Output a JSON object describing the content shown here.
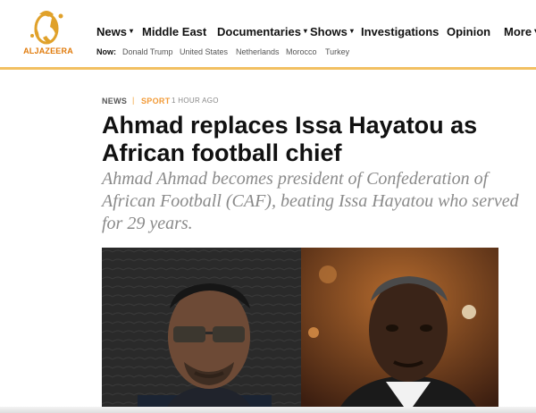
{
  "brand": {
    "name": "ALJAZEERA",
    "accent": "#f2a43a"
  },
  "nav": {
    "items": [
      {
        "label": "News",
        "dropdown": true
      },
      {
        "label": "Middle East",
        "dropdown": false
      },
      {
        "label": "Documentaries",
        "dropdown": true
      },
      {
        "label": "Shows",
        "dropdown": true
      },
      {
        "label": "Investigations",
        "dropdown": false
      },
      {
        "label": "Opinion",
        "dropdown": false
      },
      {
        "label": "More",
        "dropdown": true
      }
    ],
    "caret": "▾"
  },
  "now_bar": {
    "label": "Now:",
    "links": [
      "Donald Trump",
      "United States",
      "Netherlands",
      "Morocco",
      "Turkey"
    ]
  },
  "article": {
    "section": "NEWS",
    "separator": "|",
    "category": "SPORT",
    "time": "1 HOUR AGO",
    "headline": "Ahmad replaces Issa Hayatou as African football chief",
    "subheadline": "Ahmad Ahmad becomes president of Confederation of African Football (CAF), beating Issa Hayatou who served for 29 years."
  }
}
